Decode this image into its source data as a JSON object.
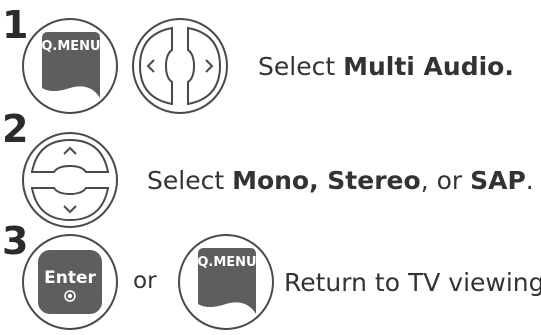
{
  "steps": [
    {
      "number": "1",
      "buttons": [
        {
          "label": "Q.MENU",
          "kind": "qmenu-key"
        },
        {
          "label": "",
          "kind": "left-right-nav-pad"
        }
      ],
      "text_prefix": "Select ",
      "text_bold": "Multi Audio."
    },
    {
      "number": "2",
      "buttons": [
        {
          "label": "",
          "kind": "up-down-nav-pad"
        }
      ],
      "text_prefix": "Select ",
      "text_bold_1": "Mono, Stereo",
      "text_mid": ", or ",
      "text_bold_2": "SAP",
      "text_suffix": "."
    },
    {
      "number": "3",
      "buttons": [
        {
          "label": "Enter",
          "kind": "enter-key"
        },
        {
          "label": "Q.MENU",
          "kind": "qmenu-key"
        }
      ],
      "or_text": "or",
      "text": "Return to TV viewing."
    }
  ],
  "colors": {
    "key_fill": "#5e5e5e",
    "pad_fill": "#ffffff",
    "outline": "#4a4a4a",
    "text": "#333333"
  }
}
